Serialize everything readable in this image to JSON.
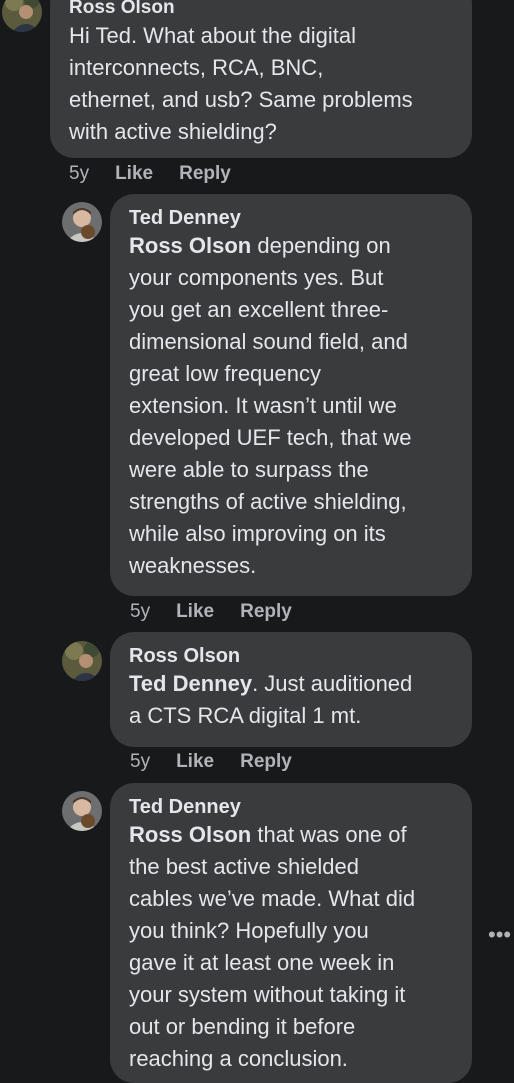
{
  "comments": [
    {
      "author": "Ross Olson",
      "text": "Hi Ted. What about the digital interconnects, RCA, BNC, ethernet, and usb? Same problems with active shielding?",
      "lines": [
        "Hi Ted. What about the digital",
        "interconnects, RCA, BNC,",
        "ethernet, and usb? Same problems",
        "with active shielding?"
      ],
      "time": "5y",
      "like": "Like",
      "reply": "Reply"
    },
    {
      "author": "Ted Denney",
      "mention": "Ross Olson",
      "lines": [
        " depending on",
        "your components yes. But",
        "you get an excellent three-",
        "dimensional sound field, and",
        "great low frequency",
        "extension. It wasn’t until we",
        "developed UEF tech, that we",
        "were able to surpass the",
        "strengths of active shielding,",
        "while also improving on its",
        "weaknesses."
      ],
      "time": "5y",
      "like": "Like",
      "reply": "Reply"
    },
    {
      "author": "Ross Olson",
      "mention": "Ted Denney",
      "lines": [
        ". Just auditioned",
        "a CTS RCA digital 1 mt."
      ],
      "time": "5y",
      "like": "Like",
      "reply": "Reply"
    },
    {
      "author": "Ted Denney",
      "mention": "Ross Olson",
      "lines": [
        " that was one of",
        "the best active shielded",
        "cables we’ve made. What did",
        "you think? Hopefully you",
        "gave it at least one week in",
        "your system without taking it",
        "out or bending it before",
        "reaching a conclusion."
      ]
    }
  ],
  "icons": {
    "more": "more-horizontal-icon",
    "more_glyph": "•••"
  },
  "colors": {
    "background": "#18191a",
    "bubble": "#3a3b3c",
    "text": "#e4e6eb",
    "meta": "#b0b3b8"
  }
}
